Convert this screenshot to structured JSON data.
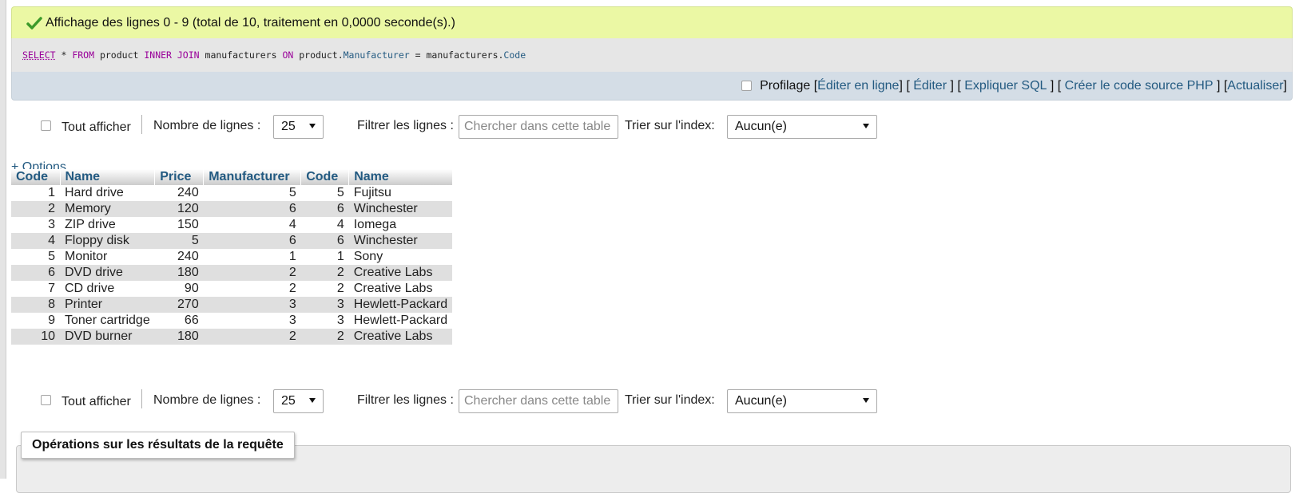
{
  "result": {
    "message": "Affichage des lignes 0 - 9 (total de 10, traitement en 0,0000 seconde(s).)"
  },
  "sql": {
    "select": "SELECT",
    "star": " * ",
    "from": "FROM",
    "t1": " product ",
    "inner_join": "INNER JOIN",
    "t2": " manufacturers ",
    "on": "ON",
    "left_table": " product.",
    "left_col": "Manufacturer",
    "eq_table": " = manufacturers.",
    "right_col": "Code"
  },
  "tools": {
    "profiling": "Profilage",
    "edit_inline": "Éditer en ligne",
    "edit": "Éditer",
    "explain": "Expliquer SQL",
    "php": "Créer le code source PHP",
    "refresh": "Actualiser"
  },
  "nav": {
    "show_all": "Tout afficher",
    "rows_label": "Nombre de lignes :",
    "rows_value": "25",
    "filter_label": "Filtrer les lignes :",
    "filter_placeholder": "Chercher dans cette table",
    "sort_label": "Trier sur l'index:",
    "sort_value": "Aucun(e)"
  },
  "options_link": "+ Options",
  "table": {
    "columns": [
      "Code",
      "Name",
      "Price",
      "Manufacturer",
      "Code",
      "Name"
    ],
    "rows": [
      [
        "1",
        "Hard drive",
        "240",
        "5",
        "5",
        "Fujitsu"
      ],
      [
        "2",
        "Memory",
        "120",
        "6",
        "6",
        "Winchester"
      ],
      [
        "3",
        "ZIP drive",
        "150",
        "4",
        "4",
        "Iomega"
      ],
      [
        "4",
        "Floppy disk",
        "5",
        "6",
        "6",
        "Winchester"
      ],
      [
        "5",
        "Monitor",
        "240",
        "1",
        "1",
        "Sony"
      ],
      [
        "6",
        "DVD drive",
        "180",
        "2",
        "2",
        "Creative Labs"
      ],
      [
        "7",
        "CD drive",
        "90",
        "2",
        "2",
        "Creative Labs"
      ],
      [
        "8",
        "Printer",
        "270",
        "3",
        "3",
        "Hewlett-Packard"
      ],
      [
        "9",
        "Toner cartridge",
        "66",
        "3",
        "3",
        "Hewlett-Packard"
      ],
      [
        "10",
        "DVD burner",
        "180",
        "2",
        "2",
        "Creative Labs"
      ]
    ]
  },
  "operations": {
    "title": "Opérations sur les résultats de la requête"
  }
}
